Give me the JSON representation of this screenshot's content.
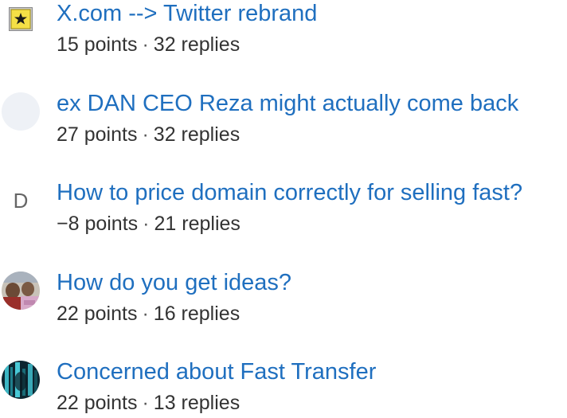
{
  "topics": [
    {
      "title": "X.com --> Twitter rebrand",
      "points": "15 points",
      "replies": "32 replies",
      "avatar": "star-flag-icon"
    },
    {
      "title": "ex DAN CEO Reza might actually come back",
      "points": "27 points",
      "replies": "32 replies",
      "avatar": "blank-avatar"
    },
    {
      "title": "How to price domain correctly for selling fast?",
      "points": "−8 points",
      "replies": "21 replies",
      "avatar": "letter-avatar",
      "avatar_letter": "D"
    },
    {
      "title": "How do you get ideas?",
      "points": "22 points",
      "replies": "16 replies",
      "avatar": "photo-avatar-people"
    },
    {
      "title": "Concerned about Fast Transfer",
      "points": "22 points",
      "replies": "13 replies",
      "avatar": "photo-avatar-teal"
    }
  ],
  "separator": "·",
  "colors": {
    "link": "#1f6fbf",
    "meta": "#333333"
  }
}
